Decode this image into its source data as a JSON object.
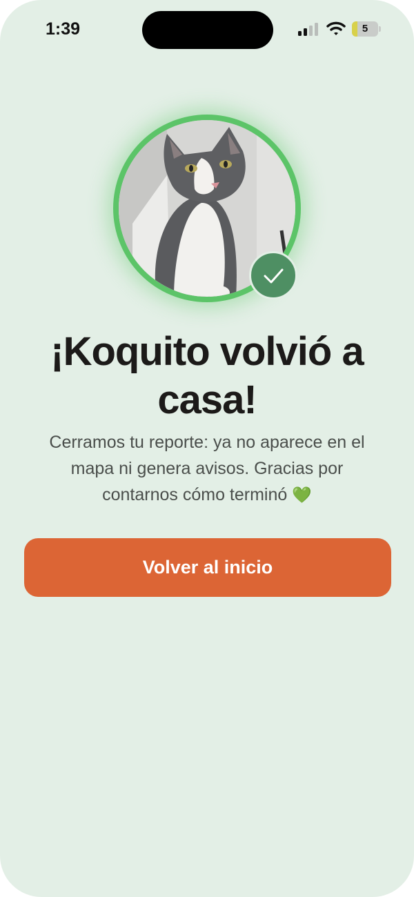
{
  "status_bar": {
    "time": "1:39",
    "battery_level": "5"
  },
  "pet": {
    "photo_alt": "gray-white-cat-photo",
    "status_icon": "check-icon"
  },
  "content": {
    "title": "¡Koquito volvió a casa!",
    "description": "Cerramos tu reporte: ya no aparece en el mapa ni genera avisos. Gracias por contarnos cómo terminó",
    "description_emoji": "💚"
  },
  "actions": {
    "primary_label": "Volver al inicio"
  },
  "colors": {
    "background": "#e3efe6",
    "ring": "#5cc468",
    "badge": "#4e8f63",
    "button": "#dc6535"
  }
}
